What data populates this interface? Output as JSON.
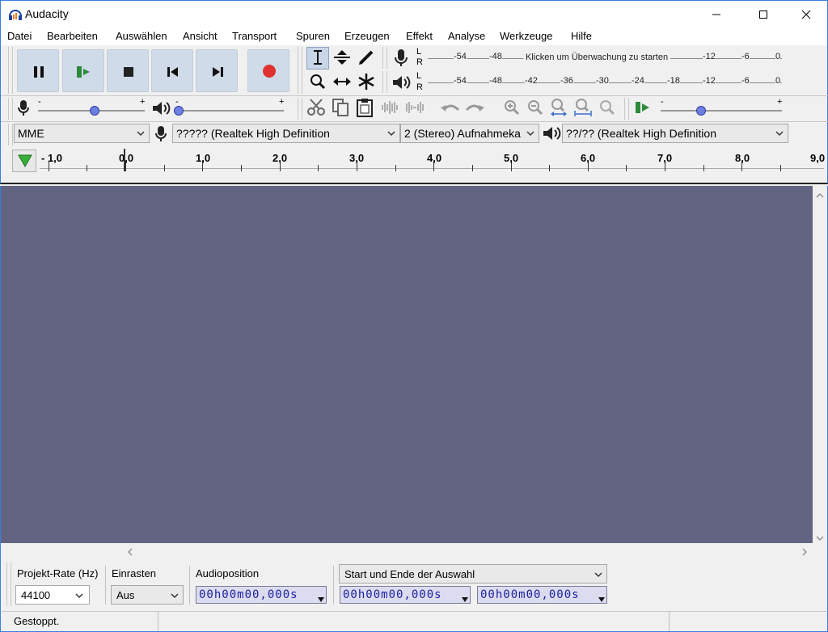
{
  "window": {
    "title": "Audacity",
    "controls": {
      "minimize": "—",
      "maximize": "☐",
      "close": "✕"
    }
  },
  "menu": [
    "Datei",
    "Bearbeiten",
    "Auswählen",
    "Ansicht",
    "Transport",
    "Spuren",
    "Erzeugen",
    "Effekt",
    "Analyse",
    "Werkzeuge",
    "Hilfe"
  ],
  "meters": {
    "record": {
      "l": "L",
      "r": "R",
      "ticks_left": [
        "-54",
        "-48"
      ],
      "prompt": "Klicken um Überwachung zu starten",
      "ticks_right": [
        "-12",
        "-6",
        "0"
      ]
    },
    "playback": {
      "l": "L",
      "r": "R",
      "ticks": [
        "-54",
        "-48",
        "-42",
        "-36",
        "-30",
        "-24",
        "-18",
        "-12",
        "-6",
        "0"
      ]
    }
  },
  "mixer": {
    "rec_minus": "-",
    "rec_plus": "+",
    "play_minus": "-",
    "play_plus": "+",
    "speed_minus": "-",
    "speed_plus": "+"
  },
  "device": {
    "host": "MME",
    "rec_device": "????? (Realtek High Definition",
    "channels": "2 (Stereo) Aufnahmeka",
    "play_device": "??/?? (Realtek High Definition"
  },
  "ruler": {
    "ticks": [
      "- 1,0",
      "0,0",
      "1,0",
      "2,0",
      "3,0",
      "4,0",
      "5,0",
      "6,0",
      "7,0",
      "8,0",
      "9,0"
    ]
  },
  "selection": {
    "rate_label": "Projekt-Rate (Hz)",
    "rate_value": "44100",
    "snap_label": "Einrasten",
    "snap_value": "Aus",
    "pos_label": "Audioposition",
    "mode_value": "Start und Ende der Auswahl",
    "pos_time": "00h00m00,000s",
    "start_time": "00h00m00,000s",
    "end_time": "00h00m00,000s"
  },
  "status": {
    "text": "Gestoppt."
  },
  "colors": {
    "track_bg": "#636482",
    "button_bg": "#cfdbe9",
    "record_red": "#e03030",
    "accent": "#3b7de0"
  }
}
